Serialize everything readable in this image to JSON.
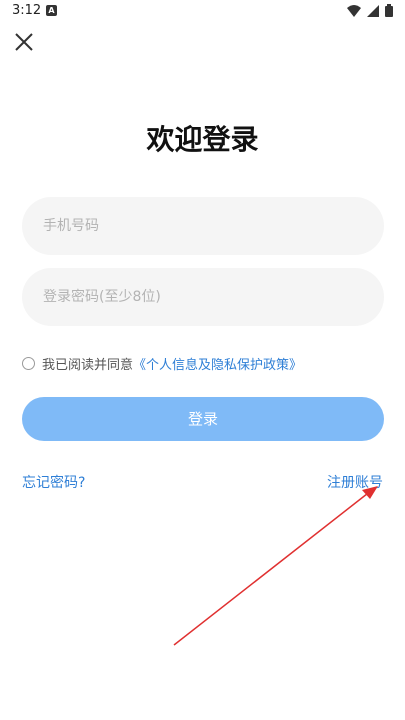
{
  "status_bar": {
    "time": "3:12",
    "indicator_letter": "A",
    "icons": [
      "wifi-icon",
      "signal-icon",
      "battery-icon"
    ]
  },
  "header": {
    "close_icon": "close-icon"
  },
  "title": "欢迎登录",
  "form": {
    "phone_placeholder": "手机号码",
    "password_placeholder": "登录密码(至少8位)",
    "agreement_prefix": "我已阅读并同意",
    "agreement_link": "《个人信息及隐私保护政策》",
    "login_label": "登录"
  },
  "links": {
    "forgot_password": "忘记密码?",
    "register": "注册账号"
  },
  "colors": {
    "primary": "#7fbaf7",
    "link": "#2f7fd6",
    "annotation": "#e03030"
  }
}
